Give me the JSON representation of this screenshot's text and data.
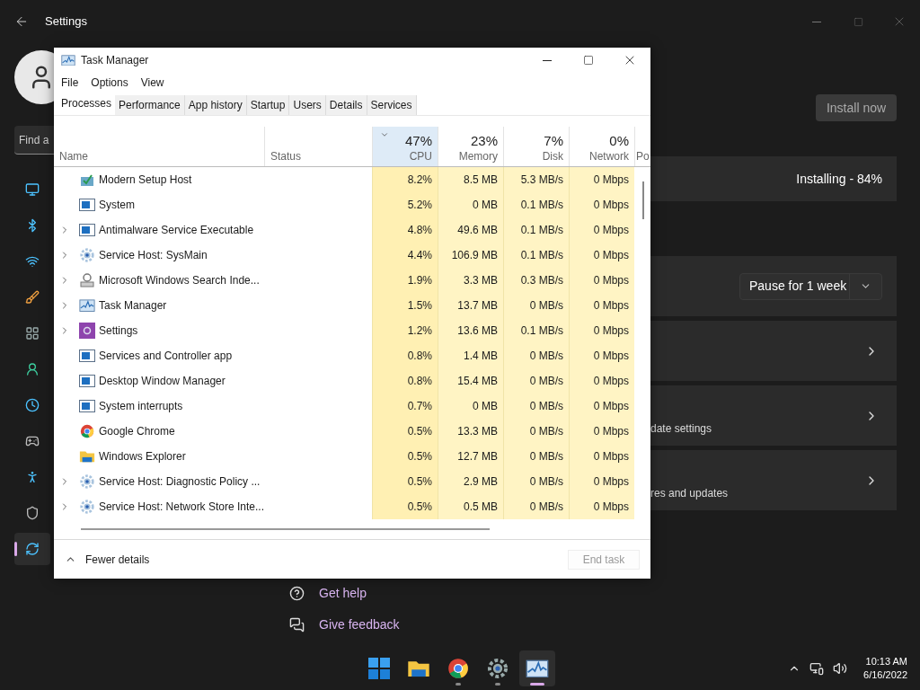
{
  "settings": {
    "title": "Settings",
    "search": {
      "placeholder": "Find a"
    },
    "nav": [
      {
        "kind": "display",
        "selected": false
      },
      {
        "kind": "bluetooth",
        "selected": false
      },
      {
        "kind": "wifi",
        "selected": false
      },
      {
        "kind": "brush",
        "selected": false
      },
      {
        "kind": "apps",
        "selected": false
      },
      {
        "kind": "person",
        "selected": false
      },
      {
        "kind": "clock",
        "selected": false
      },
      {
        "kind": "gamepad",
        "selected": false
      },
      {
        "kind": "accessibility",
        "selected": false
      },
      {
        "kind": "shield",
        "selected": false
      },
      {
        "kind": "update",
        "selected": true
      }
    ],
    "install_button": "Install now",
    "status": "Installing - 84%",
    "pause_dropdown": "Pause for 1 week",
    "link_cards": [
      {
        "kind": "blank"
      },
      {
        "kind": "labeled",
        "text": "date settings"
      },
      {
        "kind": "labeled",
        "text": "res and updates"
      }
    ],
    "help_links": [
      {
        "kind": "help",
        "text": "Get help"
      },
      {
        "kind": "feedback",
        "text": "Give feedback"
      }
    ]
  },
  "task_manager": {
    "title": "Task Manager",
    "menu": [
      "File",
      "Options",
      "View"
    ],
    "tabs": [
      {
        "label": "Processes",
        "selected": true
      },
      {
        "label": "Performance",
        "selected": false
      },
      {
        "label": "App history",
        "selected": false
      },
      {
        "label": "Startup",
        "selected": false
      },
      {
        "label": "Users",
        "selected": false
      },
      {
        "label": "Details",
        "selected": false
      },
      {
        "label": "Services",
        "selected": false
      }
    ],
    "columns": [
      {
        "label": "Name",
        "sorted": false
      },
      {
        "label": "Status",
        "sorted": false
      },
      {
        "label": "CPU",
        "total": "47%",
        "sorted": true
      },
      {
        "label": "Memory",
        "total": "23%",
        "sorted": false
      },
      {
        "label": "Disk",
        "total": "7%",
        "sorted": false
      },
      {
        "label": "Network",
        "total": "0%",
        "sorted": false
      },
      {
        "label": "Po",
        "sorted": false
      }
    ],
    "rows": [
      {
        "name": "Modern Setup Host",
        "kind": "setup",
        "expandable": false,
        "cpu": "8.2%",
        "memory": "8.5 MB",
        "disk": "5.3 MB/s",
        "network": "0 Mbps"
      },
      {
        "name": "System",
        "kind": "window",
        "expandable": false,
        "cpu": "5.2%",
        "memory": "0 MB",
        "disk": "0.1 MB/s",
        "network": "0 Mbps"
      },
      {
        "name": "Antimalware Service Executable",
        "kind": "window",
        "expandable": true,
        "cpu": "4.8%",
        "memory": "49.6 MB",
        "disk": "0.1 MB/s",
        "network": "0 Mbps"
      },
      {
        "name": "Service Host: SysMain",
        "kind": "gear",
        "expandable": true,
        "cpu": "4.4%",
        "memory": "106.9 MB",
        "disk": "0.1 MB/s",
        "network": "0 Mbps"
      },
      {
        "name": "Microsoft Windows Search Inde...",
        "kind": "indexer",
        "expandable": true,
        "cpu": "1.9%",
        "memory": "3.3 MB",
        "disk": "0.3 MB/s",
        "network": "0 Mbps"
      },
      {
        "name": "Task Manager",
        "kind": "taskmgr",
        "expandable": true,
        "cpu": "1.5%",
        "memory": "13.7 MB",
        "disk": "0 MB/s",
        "network": "0 Mbps"
      },
      {
        "name": "Settings",
        "kind": "settings",
        "expandable": true,
        "cpu": "1.2%",
        "memory": "13.6 MB",
        "disk": "0.1 MB/s",
        "network": "0 Mbps"
      },
      {
        "name": "Services and Controller app",
        "kind": "window",
        "expandable": false,
        "cpu": "0.8%",
        "memory": "1.4 MB",
        "disk": "0 MB/s",
        "network": "0 Mbps"
      },
      {
        "name": "Desktop Window Manager",
        "kind": "window",
        "expandable": false,
        "cpu": "0.8%",
        "memory": "15.4 MB",
        "disk": "0 MB/s",
        "network": "0 Mbps"
      },
      {
        "name": "System interrupts",
        "kind": "window",
        "expandable": false,
        "cpu": "0.7%",
        "memory": "0 MB",
        "disk": "0 MB/s",
        "network": "0 Mbps"
      },
      {
        "name": "Google Chrome",
        "kind": "chrome",
        "expandable": false,
        "cpu": "0.5%",
        "memory": "13.3 MB",
        "disk": "0 MB/s",
        "network": "0 Mbps"
      },
      {
        "name": "Windows Explorer",
        "kind": "folder",
        "expandable": false,
        "cpu": "0.5%",
        "memory": "12.7 MB",
        "disk": "0 MB/s",
        "network": "0 Mbps"
      },
      {
        "name": "Service Host: Diagnostic Policy ...",
        "kind": "gear",
        "expandable": true,
        "cpu": "0.5%",
        "memory": "2.9 MB",
        "disk": "0 MB/s",
        "network": "0 Mbps"
      },
      {
        "name": "Service Host: Network Store Inte...",
        "kind": "gear",
        "expandable": true,
        "cpu": "0.5%",
        "memory": "0.5 MB",
        "disk": "0 MB/s",
        "network": "0 Mbps"
      }
    ],
    "fewer_details": "Fewer details",
    "end_task": {
      "label": "End task",
      "disabled": true
    }
  },
  "taskbar": {
    "apps": [
      {
        "kind": "start",
        "running": false,
        "selected": false
      },
      {
        "kind": "folder",
        "running": false,
        "selected": false
      },
      {
        "kind": "chrome",
        "running": true,
        "selected": false
      },
      {
        "kind": "settings",
        "running": true,
        "selected": false
      },
      {
        "kind": "taskmgr",
        "running": true,
        "selected": true
      }
    ],
    "time": "10:13 AM",
    "date": "6/16/2022"
  }
}
